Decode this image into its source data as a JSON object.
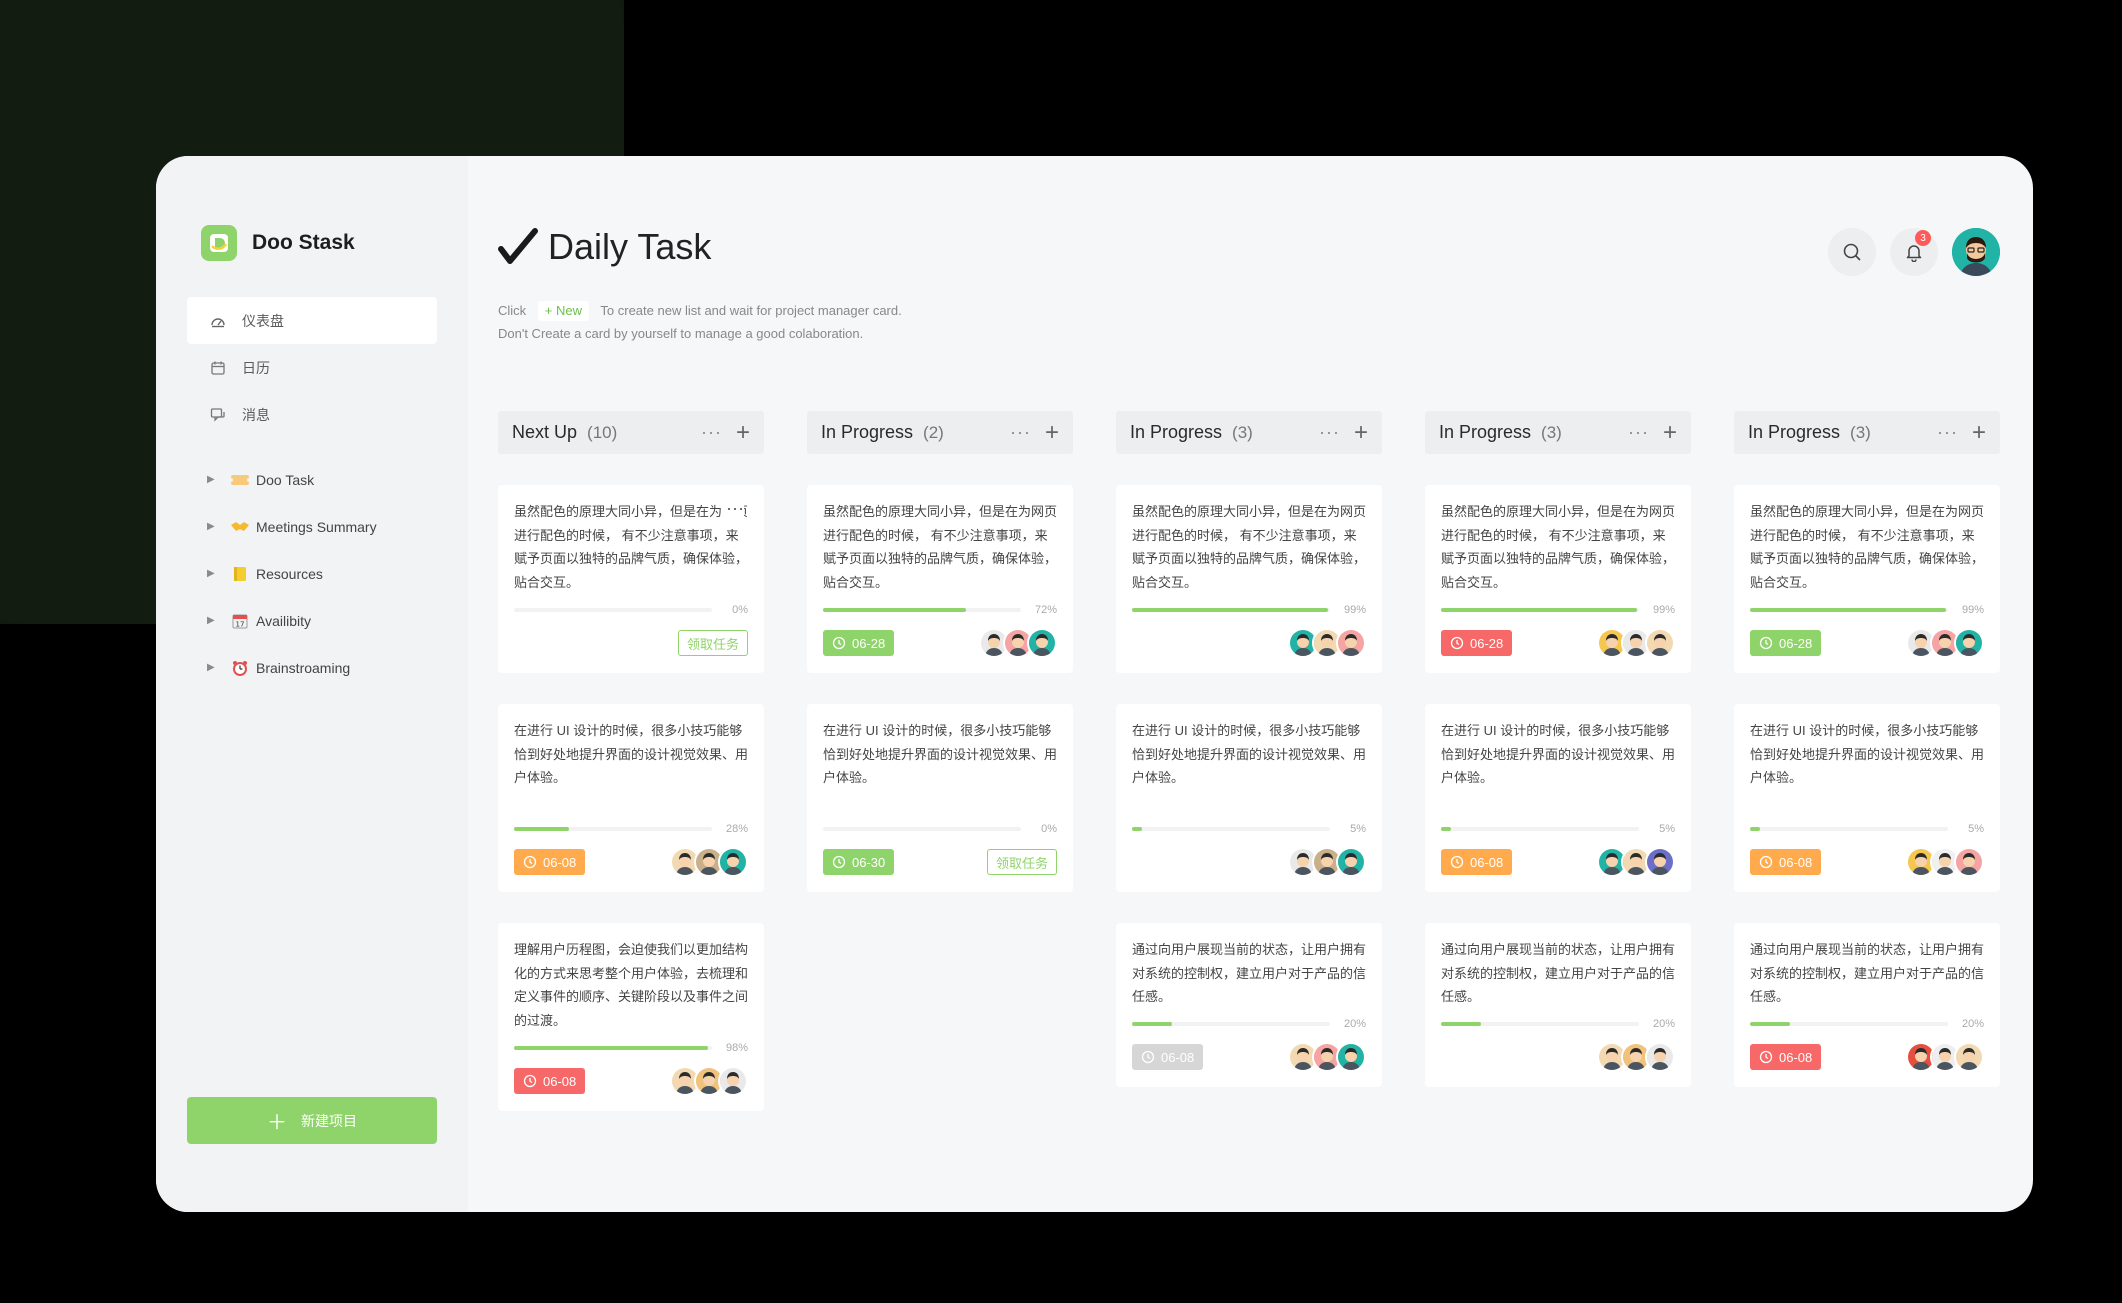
{
  "app": {
    "name": "Doo Stask"
  },
  "sidebar": {
    "nav": [
      {
        "label": "仪表盘",
        "icon": "dashboard-icon"
      },
      {
        "label": "日历",
        "icon": "calendar-icon"
      },
      {
        "label": "消息",
        "icon": "message-icon"
      }
    ],
    "projects": [
      {
        "label": "Doo Task",
        "emoji": "ticket-emoji"
      },
      {
        "label": "Meetings Summary",
        "emoji": "handshake-emoji"
      },
      {
        "label": "Resources",
        "emoji": "notebook-emoji"
      },
      {
        "label": "Availibity",
        "emoji": "calendar-emoji"
      },
      {
        "label": "Brainstroaming",
        "emoji": "alarm-clock-emoji"
      }
    ],
    "new_project_label": "新建项目"
  },
  "header": {
    "title": "Daily Task",
    "hint_prefix": "Click",
    "hint_new": "+ New",
    "hint_suffix": "To create new list and wait for project manager card.",
    "hint_line2": "Don't Create a card by yourself to manage a good colaboration.",
    "notification_count": "3"
  },
  "colors": {
    "accent": "#8fd46a",
    "danger": "#f76868",
    "warning": "#ffab4d",
    "muted": "#d6d6d6"
  },
  "columns": [
    {
      "title": "Next Up",
      "count": "(10)",
      "cards": [
        {
          "text": "虽然配色的原理大同小异，但是在为网页进行配色的时候， 有不少注意事项，来赋予页面以独特的品牌气质，确保体验，贴合交互。",
          "progress": "0%",
          "fill": 0,
          "date": "",
          "status": "claim",
          "claim": "领取任务",
          "avatars": [],
          "dots": true
        },
        {
          "text": "在进行 UI 设计的时候，很多小技巧能够恰到好处地提升界面的设计视觉效果、用户体验。",
          "progress": "28%",
          "fill": 28,
          "date": "06-08",
          "status": "orange",
          "avatars": [
            "#f3d9b1",
            "#c9b08a",
            "#21b3a5"
          ]
        },
        {
          "text": "理解用户历程图，会迫使我们以更加结构化的方式来思考整个用户体验，去梳理和定义事件的顺序、关键阶段以及事件之间的过渡。",
          "progress": "98%",
          "fill": 98,
          "date": "06-08",
          "status": "red",
          "avatars": [
            "#f3d9b1",
            "#f0c27b",
            "#e9e9e9"
          ]
        }
      ]
    },
    {
      "title": "In Progress",
      "count": "(2)",
      "cards": [
        {
          "text": "虽然配色的原理大同小异，但是在为网页进行配色的时候， 有不少注意事项，来赋予页面以独特的品牌气质，确保体验，贴合交互。",
          "progress": "72%",
          "fill": 72,
          "date": "06-28",
          "status": "green",
          "avatars": [
            "#e9e9e9",
            "#f5a3a3",
            "#21b3a5"
          ]
        },
        {
          "text": "在进行 UI 设计的时候，很多小技巧能够恰到好处地提升界面的设计视觉效果、用户体验。",
          "progress": "0%",
          "fill": 0,
          "date": "06-30",
          "status": "green",
          "claim": "领取任务",
          "avatars": [],
          "has_claim": true
        }
      ]
    },
    {
      "title": "In Progress",
      "count": "(3)",
      "cards": [
        {
          "text": "虽然配色的原理大同小异，但是在为网页进行配色的时候， 有不少注意事项，来赋予页面以独特的品牌气质，确保体验，贴合交互。",
          "progress": "99%",
          "fill": 99,
          "date": "",
          "status": "none",
          "avatars": [
            "#21b3a5",
            "#f3d9b1",
            "#f5a3a3"
          ]
        },
        {
          "text": "在进行 UI 设计的时候，很多小技巧能够恰到好处地提升界面的设计视觉效果、用户体验。",
          "progress": "5%",
          "fill": 5,
          "date": "",
          "status": "none",
          "avatars": [
            "#e9e9e9",
            "#c9b08a",
            "#21b3a5"
          ]
        },
        {
          "text": "通过向用户展现当前的状态，让用户拥有对系统的控制权，建立用户对于产品的信任感。",
          "progress": "20%",
          "fill": 20,
          "date": "06-08",
          "status": "gray",
          "avatars": [
            "#f3d9b1",
            "#f5a3a3",
            "#21b3a5"
          ],
          "short": true
        }
      ]
    },
    {
      "title": "In Progress",
      "count": "(3)",
      "cards": [
        {
          "text": "虽然配色的原理大同小异，但是在为网页进行配色的时候， 有不少注意事项，来赋予页面以独特的品牌气质，确保体验，贴合交互。",
          "progress": "99%",
          "fill": 99,
          "date": "06-28",
          "status": "red",
          "avatars": [
            "#f5c74e",
            "#e9e9e9",
            "#f3d9b1"
          ]
        },
        {
          "text": "在进行 UI 设计的时候，很多小技巧能够恰到好处地提升界面的设计视觉效果、用户体验。",
          "progress": "5%",
          "fill": 5,
          "date": "06-08",
          "status": "orange",
          "avatars": [
            "#21b3a5",
            "#f3d9b1",
            "#6b6fc9"
          ]
        },
        {
          "text": "通过向用户展现当前的状态，让用户拥有对系统的控制权，建立用户对于产品的信任感。",
          "progress": "20%",
          "fill": 20,
          "date": "",
          "status": "none",
          "avatars": [
            "#f3d9b1",
            "#f0c27b",
            "#e9e9e9"
          ],
          "short": true
        }
      ]
    },
    {
      "title": "In Progress",
      "count": "(3)",
      "cards": [
        {
          "text": "虽然配色的原理大同小异，但是在为网页进行配色的时候， 有不少注意事项，来赋予页面以独特的品牌气质，确保体验，贴合交互。",
          "progress": "99%",
          "fill": 99,
          "date": "06-28",
          "status": "green",
          "avatars": [
            "#e9e9e9",
            "#f5a3a3",
            "#21b3a5"
          ]
        },
        {
          "text": "在进行 UI 设计的时候，很多小技巧能够恰到好处地提升界面的设计视觉效果、用户体验。",
          "progress": "5%",
          "fill": 5,
          "date": "06-08",
          "status": "orange",
          "avatars": [
            "#f5c74e",
            "#f0f0f0",
            "#f5a3a3"
          ]
        },
        {
          "text": "通过向用户展现当前的状态，让用户拥有对系统的控制权，建立用户对于产品的信任感。",
          "progress": "20%",
          "fill": 20,
          "date": "06-08",
          "status": "red",
          "avatars": [
            "#e3503f",
            "#eeeeee",
            "#f3d9b1"
          ],
          "short": true
        }
      ]
    }
  ]
}
